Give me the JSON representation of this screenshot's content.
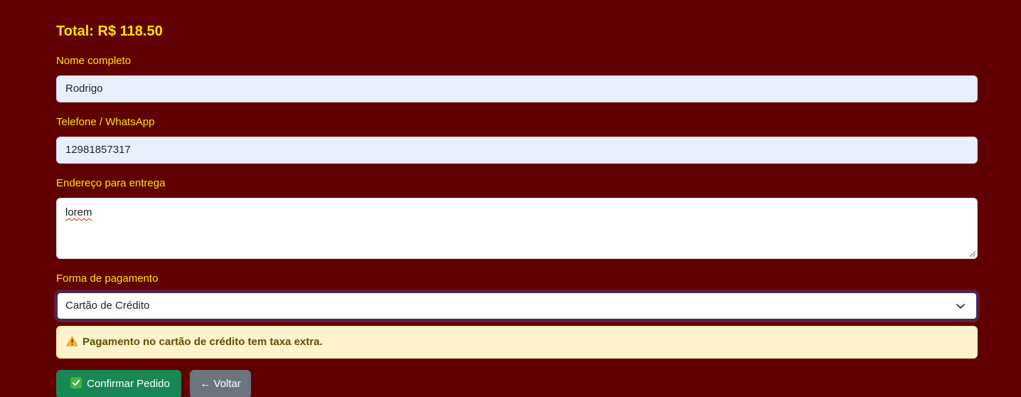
{
  "order": {
    "total_label": "Total: R$ 118.50"
  },
  "form": {
    "name": {
      "label": "Nome completo",
      "value": "Rodrigo"
    },
    "phone": {
      "label": "Telefone / WhatsApp",
      "value": "12981857317"
    },
    "address": {
      "label": "Endereço para entrega",
      "value": "lorem"
    },
    "payment": {
      "label": "Forma de pagamento",
      "selected": "Cartão de Crédito"
    }
  },
  "alert": {
    "icon": "warning-icon",
    "text": "Pagamento no cartão de crédito tem taxa extra."
  },
  "actions": {
    "confirm_icon": "check-box-icon",
    "confirm_label": "Confirmar Pedido",
    "back_label": "← Voltar"
  },
  "colors": {
    "background": "#600000",
    "label": "#ffe100",
    "confirm": "#198754",
    "back": "#6c757d",
    "alert_bg": "#fff3cd",
    "alert_text": "#664d03"
  }
}
